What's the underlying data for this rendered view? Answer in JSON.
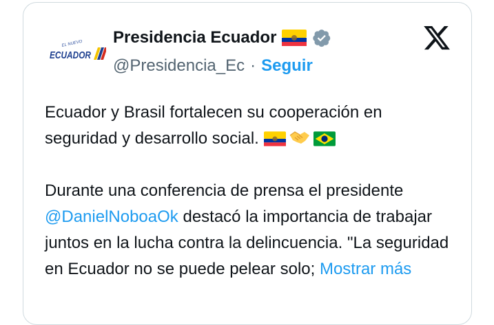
{
  "tweet": {
    "display_name": "Presidencia Ecuador",
    "handle": "@Presidencia_Ec",
    "separator": "·",
    "follow_label": "Seguir",
    "avatar_text": {
      "small": "EL NUEVO",
      "large": "ECUADOR"
    },
    "paragraph1": "Ecuador y Brasil fortalecen su cooperación en seguridad y desarrollo social.",
    "paragraph2_before": "Durante una conferencia de prensa el presidente ",
    "mention": "@DanielNoboaOk",
    "paragraph2_after": " destacó la importancia de trabajar juntos en la lucha contra la delincuencia. \"La seguridad en Ecuador no se puede pelear solo; ",
    "show_more_label": "Mostrar más"
  },
  "icons": {
    "name_flag": "ecuador-flag-icon",
    "verified": "verified-badge-icon",
    "platform_logo": "x-logo-icon",
    "emoji_sequence": [
      "ecuador-flag-icon",
      "handshake-icon",
      "brazil-flag-icon"
    ]
  },
  "colors": {
    "link": "#1d9bf0",
    "text": "#0f1419",
    "secondary": "#536471",
    "border": "#cfd9de",
    "verified_badge": "#829aab"
  }
}
